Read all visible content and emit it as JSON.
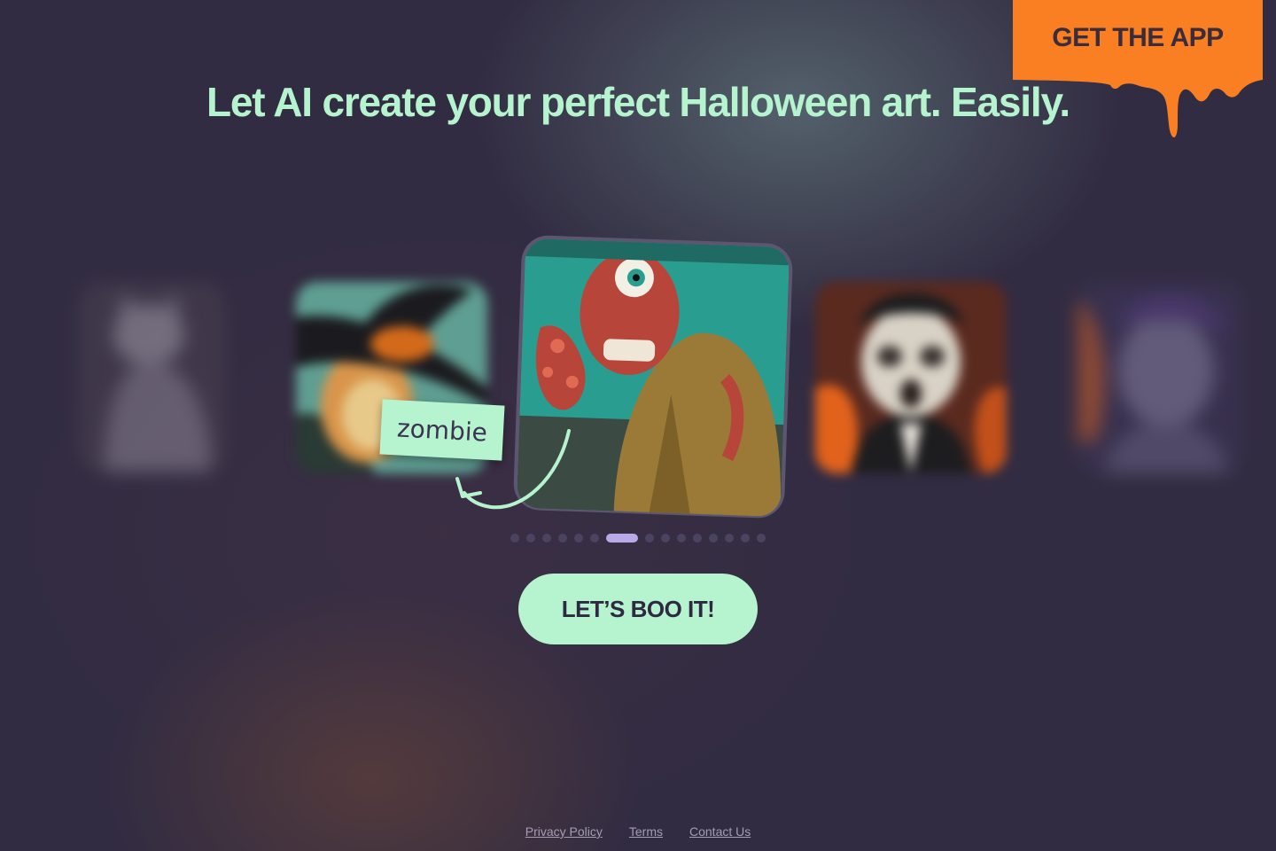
{
  "header": {
    "get_app_label": "GET THE APP",
    "headline": "Let AI create your perfect Halloween art. Easily."
  },
  "carousel": {
    "prompt_label": "zombie",
    "tiles": [
      {
        "subject": "cat"
      },
      {
        "subject": "witch"
      },
      {
        "subject": "zombie"
      },
      {
        "subject": "vampire"
      },
      {
        "subject": "ghoul"
      }
    ],
    "dot_count": 15,
    "active_index": 6
  },
  "cta": {
    "label": "LET’S BOO IT!"
  },
  "footer": {
    "privacy": "Privacy Policy",
    "terms": "Terms",
    "contact": "Contact Us"
  },
  "colors": {
    "background": "#322c42",
    "accent_mint": "#b6f3cf",
    "accent_orange": "#fa7f23",
    "dot_active": "#b9a9e6"
  }
}
